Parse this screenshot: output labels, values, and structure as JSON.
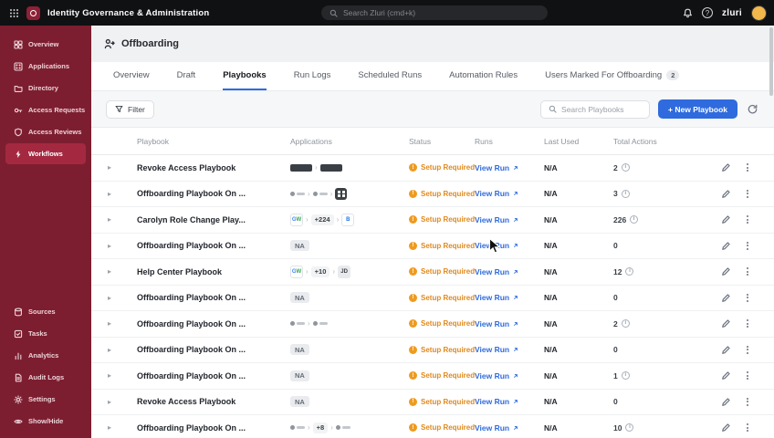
{
  "colors": {
    "accent": "#2f6bde",
    "sidebar": "#7d1e30",
    "topbar": "#101113",
    "warning": "#ef9b1f"
  },
  "topbar": {
    "title": "Identity Governance & Administration",
    "search_placeholder": "Search Zluri (cmd+k)",
    "brand": "zluri"
  },
  "sidebar": {
    "main_items": [
      {
        "label": "Overview",
        "icon": "overview-icon"
      },
      {
        "label": "Applications",
        "icon": "applications-icon"
      },
      {
        "label": "Directory",
        "icon": "directory-icon"
      },
      {
        "label": "Access Requests",
        "icon": "access-requests-icon"
      },
      {
        "label": "Access Reviews",
        "icon": "access-reviews-icon"
      },
      {
        "label": "Workflows",
        "icon": "workflows-icon",
        "active": true
      }
    ],
    "bottom_items": [
      {
        "label": "Sources",
        "icon": "sources-icon"
      },
      {
        "label": "Tasks",
        "icon": "tasks-icon"
      },
      {
        "label": "Analytics",
        "icon": "analytics-icon"
      },
      {
        "label": "Audit Logs",
        "icon": "audit-logs-icon"
      },
      {
        "label": "Settings",
        "icon": "settings-icon"
      },
      {
        "label": "Show/Hide",
        "icon": "show-hide-icon"
      }
    ]
  },
  "page": {
    "title": "Offboarding",
    "tabs": [
      {
        "label": "Overview"
      },
      {
        "label": "Draft"
      },
      {
        "label": "Playbooks",
        "active": true
      },
      {
        "label": "Run Logs"
      },
      {
        "label": "Scheduled Runs"
      },
      {
        "label": "Automation Rules"
      },
      {
        "label": "Users Marked For Offboarding",
        "badge": "2"
      }
    ],
    "toolbar": {
      "filter_label": "Filter",
      "search_placeholder": "Search Playbooks",
      "new_button_label": "+ New Playbook"
    }
  },
  "table": {
    "columns": [
      "Playbook",
      "Applications",
      "Status",
      "Runs",
      "Last Used",
      "Total Actions"
    ],
    "status_label": "Setup Required",
    "run_link_label": "View Run",
    "last_used_value": "N/A",
    "rows": [
      {
        "name": "Revoke Access Playbook",
        "apps": [
          {
            "kind": "wordmark"
          },
          {
            "kind": "wordmark"
          }
        ],
        "total": "2",
        "info": true
      },
      {
        "name": "Offboarding Playbook On ...",
        "apps": [
          {
            "kind": "mini"
          },
          {
            "kind": "mini"
          },
          {
            "kind": "more-badge"
          }
        ],
        "total": "3",
        "info": true
      },
      {
        "name": "Carolyn Role Change Play...",
        "apps": [
          {
            "kind": "chip",
            "label": "GW"
          },
          {
            "kind": "count",
            "label": "+224"
          },
          {
            "kind": "chip",
            "label": "B"
          }
        ],
        "total": "226",
        "info": true
      },
      {
        "name": "Offboarding Playbook On ...",
        "apps": [
          {
            "kind": "na",
            "label": "NA"
          }
        ],
        "total": "0",
        "info": false
      },
      {
        "name": "Help Center Playbook",
        "apps": [
          {
            "kind": "chip",
            "label": "GW"
          },
          {
            "kind": "count",
            "label": "+10"
          },
          {
            "kind": "chip",
            "label": "JD"
          }
        ],
        "total": "12",
        "info": true
      },
      {
        "name": "Offboarding Playbook On ...",
        "apps": [
          {
            "kind": "na",
            "label": "NA"
          }
        ],
        "total": "0",
        "info": false
      },
      {
        "name": "Offboarding Playbook On ...",
        "apps": [
          {
            "kind": "mini"
          },
          {
            "kind": "mini"
          }
        ],
        "total": "2",
        "info": true
      },
      {
        "name": "Offboarding Playbook On ...",
        "apps": [
          {
            "kind": "na",
            "label": "NA"
          }
        ],
        "total": "0",
        "info": false
      },
      {
        "name": "Offboarding Playbook On ...",
        "apps": [
          {
            "kind": "na",
            "label": "NA"
          }
        ],
        "total": "1",
        "info": true
      },
      {
        "name": "Revoke Access Playbook",
        "apps": [
          {
            "kind": "na",
            "label": "NA"
          }
        ],
        "total": "0",
        "info": false
      },
      {
        "name": "Offboarding Playbook On ...",
        "apps": [
          {
            "kind": "mini"
          },
          {
            "kind": "count",
            "label": "+8"
          },
          {
            "kind": "mini"
          }
        ],
        "total": "10",
        "info": true
      }
    ]
  }
}
